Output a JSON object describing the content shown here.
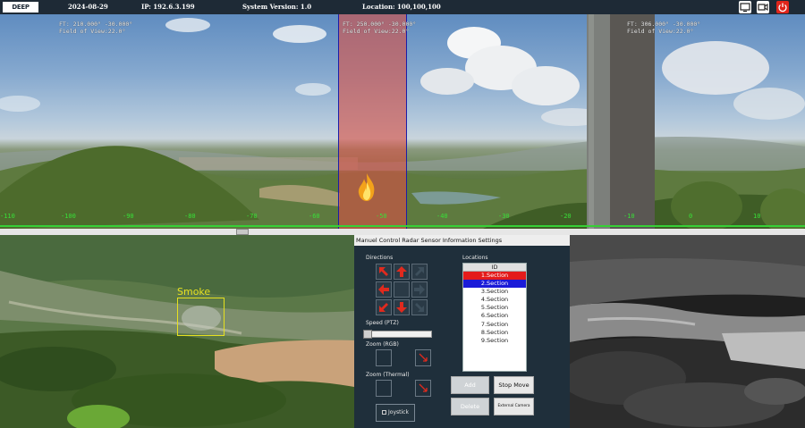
{
  "topbar": {
    "logo_text": "DEEP",
    "date": "2024-08-29",
    "ip": "IP: 192.6.3.199",
    "version": "System Version: 1.0",
    "location": "Location: 100,100,100",
    "buttons": [
      {
        "icon": "monitor-icon"
      },
      {
        "icon": "camera-icon"
      },
      {
        "icon": "power-icon",
        "color": "#e0251b"
      }
    ]
  },
  "panorama": {
    "fov_left": {
      "line1": "FT: 210.000° -30.000°",
      "line2": "Field of View:22.0°"
    },
    "fov_center": {
      "line1": "FT: 250.000° -30.000°",
      "line2": "Field of View:22.0°"
    },
    "fov_right": {
      "line1": "FT: 306.000° -30.000°",
      "line2": "Field of View:22.0°"
    },
    "scale_ticks": [
      "-110",
      "-100",
      "-90",
      "-80",
      "-70",
      "-60",
      "-50",
      "-40",
      "-30",
      "-20",
      "-10",
      "0",
      "10"
    ],
    "focus_color": "#d65046",
    "scale_color": "#36d036"
  },
  "left_camera": {
    "detection_label": "Smoke",
    "detection_color": "#e6e020"
  },
  "panel": {
    "menu": "Manuel Control Radar Sensor Information Settings",
    "directions_label": "Directions",
    "speed_label": "Speed (PTZ)",
    "speed_value": 0.1,
    "zoom_rgb_label": "Zoom (RGB)",
    "zoom_thermal_label": "Zoom (Thermal)",
    "joystick_label": "Joystick",
    "locations_label": "Locations",
    "locations_header": "ID",
    "locations": [
      "1.Section",
      "2.Section",
      "3.Section",
      "4.Section",
      "5.Section",
      "6.Section",
      "7.Section",
      "8.Section",
      "9.Section"
    ],
    "selected_colors": [
      "#e41b1b",
      "#1b1bd8"
    ],
    "buttons": {
      "add": "Add",
      "stop_move": "Stop Move",
      "delete": "Delete",
      "external_camera": "External Camera"
    },
    "arrow_color": "#e02a1e"
  }
}
